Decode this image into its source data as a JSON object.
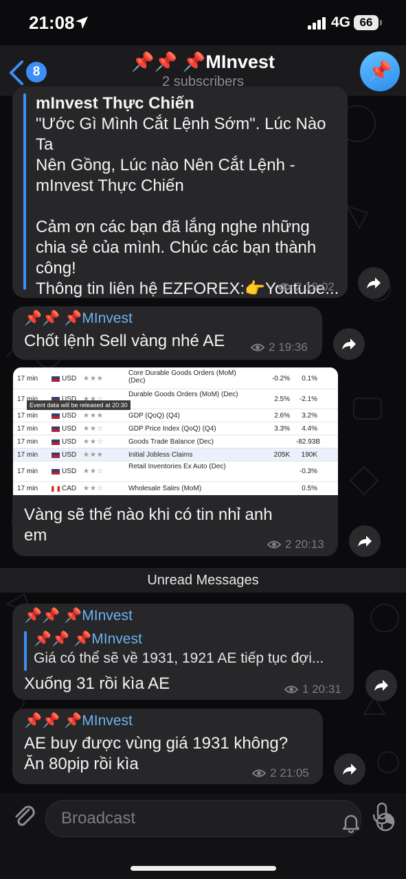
{
  "status_bar": {
    "time": "21:08",
    "network": "4G",
    "battery": "66"
  },
  "header": {
    "back_count": "8",
    "channel_name": "📌📌 📌MInvest",
    "subtitle": "2 subscribers",
    "avatar_emoji": "📌"
  },
  "messages": [
    {
      "lines": [
        "mInvest Thực Chiến",
        "\"Ước Gì Mình Cắt Lệnh Sớm\". Lúc Nào Ta",
        "Nên Gồng, Lúc nào Nên Cắt Lệnh -",
        "mInvest Thực Chiến",
        "",
        "Cảm ơn các bạn đã lắng nghe những",
        "chia sẻ của mình. Chúc các bạn thành",
        "công!",
        "Thông tin liên hệ EZFOREX:👉Youtube..."
      ],
      "views": "2",
      "time": "19:02"
    },
    {
      "sender": "📌📌 📌MInvest",
      "text": "Chốt lệnh Sell vàng nhé AE",
      "views": "2",
      "time": "19:36"
    },
    {
      "calendar": {
        "tooltip": "Event data will be released at 20:30",
        "rows": [
          {
            "time": "17 min",
            "currency": "USD",
            "stars": "★★★",
            "event": "Core Durable Goods Orders (MoM) (Dec)",
            "actual": "-0.2%",
            "forecast": "0.1%"
          },
          {
            "time": "17 min",
            "currency": "USD",
            "stars": "★★☆",
            "event": "Durable Goods Orders (MoM) (Dec)",
            "actual": "2.5%",
            "forecast": "-2.1%"
          },
          {
            "time": "17 min",
            "currency": "USD",
            "stars": "★★★",
            "event": "GDP (QoQ) (Q4)",
            "actual": "2.6%",
            "forecast": "3.2%"
          },
          {
            "time": "17 min",
            "currency": "USD",
            "stars": "★★☆",
            "event": "GDP Price Index (QoQ) (Q4)",
            "actual": "3.3%",
            "forecast": "4.4%"
          },
          {
            "time": "17 min",
            "currency": "USD",
            "stars": "★★☆",
            "event": "Goods Trade Balance (Dec)",
            "actual": "",
            "forecast": "-82.93B"
          },
          {
            "time": "17 min",
            "currency": "USD",
            "stars": "★★★",
            "event": "Initial Jobless Claims",
            "actual": "205K",
            "forecast": "190K"
          },
          {
            "time": "17 min",
            "currency": "USD",
            "stars": "★★☆",
            "event": "Retail Inventories Ex Auto (Dec)",
            "actual": "",
            "forecast": "-0.3%"
          },
          {
            "time": "17 min",
            "currency": "CAD",
            "stars": "★★☆",
            "event": "Wholesale Sales (MoM)",
            "actual": "",
            "forecast": "0.5%"
          }
        ]
      },
      "lines": [
        "Vàng sẽ thế nào khi có tin nhỉ anh",
        "em"
      ],
      "views": "2",
      "time": "20:13"
    },
    {
      "sender": "📌📌 📌MInvest",
      "quote_sender": "📌📌 📌MInvest",
      "quote_text": "Giá có thể sẽ về 1931, 1921 AE tiếp tục đợi...",
      "text": "Xuống 31 rồi kìa AE",
      "views": "1",
      "time": "20:31"
    },
    {
      "sender": "📌📌 📌MInvest",
      "lines": [
        "AE buy được vùng giá 1931 không?",
        "Ăn 80pip rồi kìa"
      ],
      "views": "2",
      "time": "21:05"
    }
  ],
  "unread_label": "Unread Messages",
  "input": {
    "placeholder": "Broadcast"
  }
}
